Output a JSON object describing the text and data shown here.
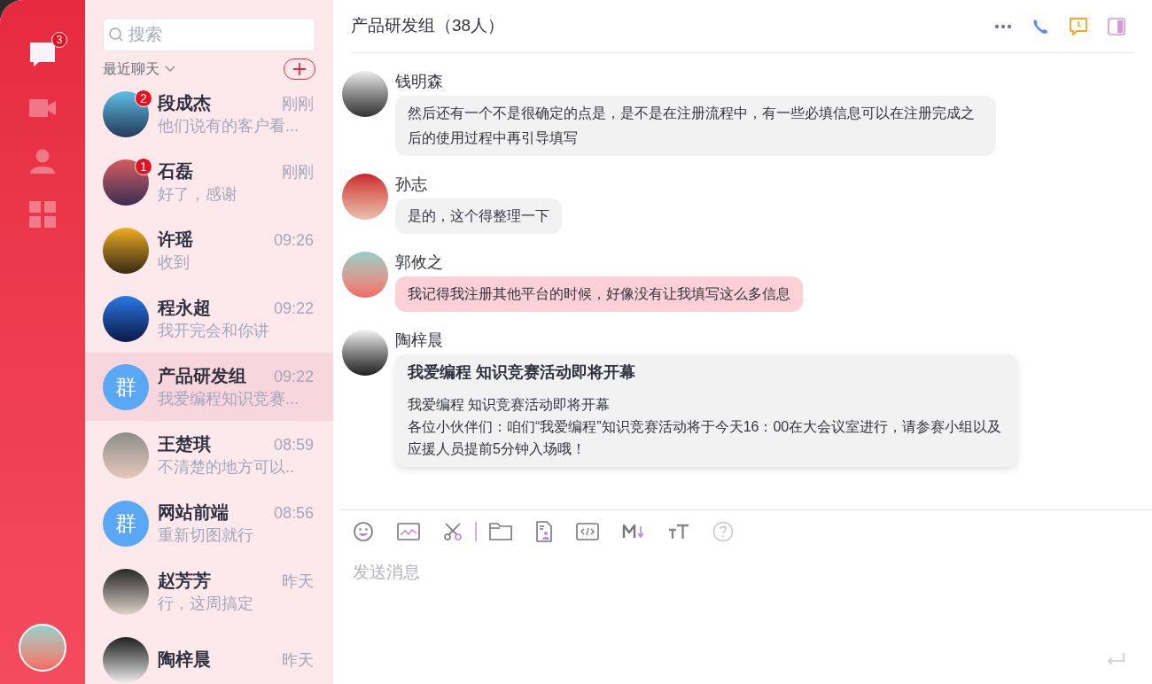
{
  "nav": [
    {
      "kind": "chat",
      "selected": true,
      "badge": "3"
    },
    {
      "kind": "video",
      "selected": false
    },
    {
      "kind": "contacts",
      "selected": false
    },
    {
      "kind": "apps",
      "selected": false
    }
  ],
  "search": {
    "placeholder": "搜索"
  },
  "list_header": {
    "label": "最近聊天"
  },
  "chats": [
    {
      "name": "段成杰",
      "time": "刚刚",
      "preview": "他们说有的客户看...",
      "kind": "photo",
      "badge": "2",
      "selected": false
    },
    {
      "name": "石磊",
      "time": "刚刚",
      "preview": "好了，感谢",
      "kind": "photo",
      "badge": "1",
      "selected": false
    },
    {
      "name": "许瑶",
      "time": "09:26",
      "preview": "收到",
      "kind": "photo",
      "selected": false
    },
    {
      "name": "程永超",
      "time": "09:22",
      "preview": "我开完会和你讲",
      "kind": "photo",
      "selected": false
    },
    {
      "name": "产品研发组",
      "time": "09:22",
      "preview": "我爱编程知识竞赛...",
      "kind": "group",
      "avatar_text": "群",
      "selected": true
    },
    {
      "name": "王楚琪",
      "time": "08:59",
      "preview": "不清楚的地方可以..",
      "kind": "photo",
      "selected": false
    },
    {
      "name": "网站前端",
      "time": "08:56",
      "preview": "重新切图就行",
      "kind": "group",
      "avatar_text": "群",
      "selected": false
    },
    {
      "name": "赵芳芳",
      "time": "昨天",
      "preview": "行，这周搞定",
      "kind": "photo",
      "selected": false
    },
    {
      "name": "陶梓晨",
      "time": "昨天",
      "kind": "photo",
      "selected": false
    }
  ],
  "conversation": {
    "title": "产品研发组（38人）",
    "messages": [
      {
        "sender": "钱明森",
        "kind": "plain",
        "text": "然后还有一个不是很确定的点是，是不是在注册流程中，有一些必填信息可以在注册完成之后的使用过程中再引导填写"
      },
      {
        "sender": "孙志",
        "kind": "plain",
        "text": "是的，这个得整理一下"
      },
      {
        "sender": "郭攸之",
        "kind": "highlight",
        "text": "我记得我注册其他平台的时候，好像没有让我填写这么多信息"
      },
      {
        "sender": "陶梓晨",
        "kind": "card",
        "title": "我爱编程 知识竞赛活动即将开幕",
        "paragraphs": [
          "我爱编程 知识竞赛活动即将开幕",
          "各位小伙伴们：咱们“我爱编程”知识竞赛活动将于今天16：00在大会议室进行，请参赛小组以及应援人员提前5分钟入场哦！"
        ]
      }
    ]
  },
  "composer": {
    "placeholder": "发送消息"
  }
}
